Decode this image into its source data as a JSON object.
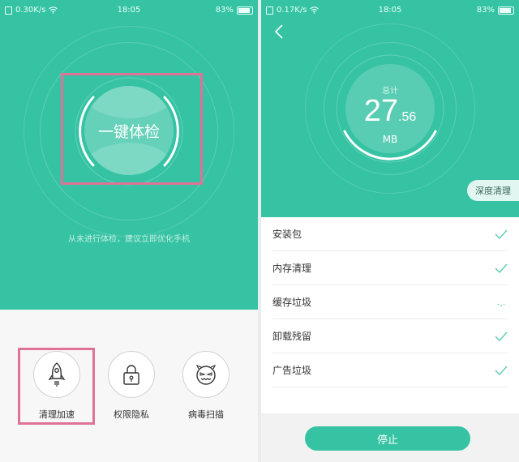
{
  "left": {
    "status": {
      "speed": "0.30K/s",
      "time": "18:05",
      "battery": "83%"
    },
    "checkup_button": "一键体检",
    "hint": "从未进行体检，建议立即优化手机",
    "tools": [
      {
        "label": "清理加速",
        "icon": "rocket-icon"
      },
      {
        "label": "权限隐私",
        "icon": "lock-icon"
      },
      {
        "label": "病毒扫描",
        "icon": "virus-face-icon"
      }
    ]
  },
  "right": {
    "status": {
      "speed": "0.17K/s",
      "time": "18:05",
      "battery": "83%"
    },
    "total_label": "总计",
    "total_integer": "27",
    "total_decimal": ".56",
    "total_unit": "MB",
    "deep_clean": "深度清理",
    "items": [
      {
        "label": "安装包",
        "state": "done"
      },
      {
        "label": "内存清理",
        "state": "done"
      },
      {
        "label": "缓存垃圾",
        "state": "scanning"
      },
      {
        "label": "卸载残留",
        "state": "done"
      },
      {
        "label": "广告垃圾",
        "state": "done"
      }
    ],
    "stop": "停止"
  },
  "colors": {
    "primary_teal": "#35c3a3",
    "highlight_pink": "#e07197",
    "check_teal": "#5cc8b4"
  }
}
